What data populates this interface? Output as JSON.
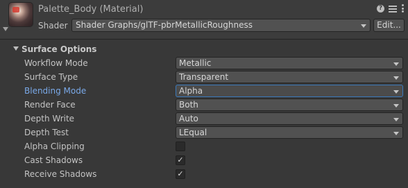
{
  "header": {
    "title": "Palette_Body (Material)",
    "shader_label": "Shader",
    "shader_value": "Shader Graphs/glTF-pbrMetallicRoughness",
    "edit_label": "Edit...",
    "help_icon_glyph": "?"
  },
  "surface_options": {
    "title": "Surface Options",
    "workflow_mode": {
      "label": "Workflow Mode",
      "value": "Metallic"
    },
    "surface_type": {
      "label": "Surface Type",
      "value": "Transparent"
    },
    "blending_mode": {
      "label": "Blending Mode",
      "value": "Alpha"
    },
    "render_face": {
      "label": "Render Face",
      "value": "Both"
    },
    "depth_write": {
      "label": "Depth Write",
      "value": "Auto"
    },
    "depth_test": {
      "label": "Depth Test",
      "value": "LEqual"
    },
    "alpha_clipping": {
      "label": "Alpha Clipping",
      "checked": false,
      "mark": ""
    },
    "cast_shadows": {
      "label": "Cast Shadows",
      "checked": true,
      "mark": "✓"
    },
    "receive_shadows": {
      "label": "Receive Shadows",
      "checked": true,
      "mark": "✓"
    }
  },
  "colors": {
    "background": "#383838",
    "dropdown": "#515151",
    "focus_border": "#3a79bb",
    "highlight_label": "#7aa9e8"
  }
}
